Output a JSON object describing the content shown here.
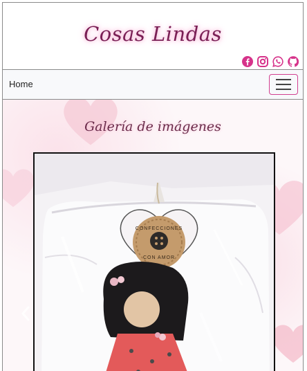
{
  "site": {
    "brand": "Cosas Lindas"
  },
  "social": [
    {
      "name": "facebook-icon",
      "color": "#d6338a"
    },
    {
      "name": "instagram-icon",
      "color": "#d6338a"
    },
    {
      "name": "whatsapp-icon",
      "color": "#d6338a"
    },
    {
      "name": "github-icon",
      "color": "#d6338a"
    }
  ],
  "nav": {
    "home_label": "Home",
    "toggler_icon": "hamburger-menu-icon"
  },
  "gallery": {
    "title": "Galería de imágenes",
    "tag_text": [
      "CONFECCIONES",
      "CON AMOR"
    ]
  },
  "colors": {
    "accent": "#d13f8f",
    "brand_text": "#7a1f55"
  }
}
